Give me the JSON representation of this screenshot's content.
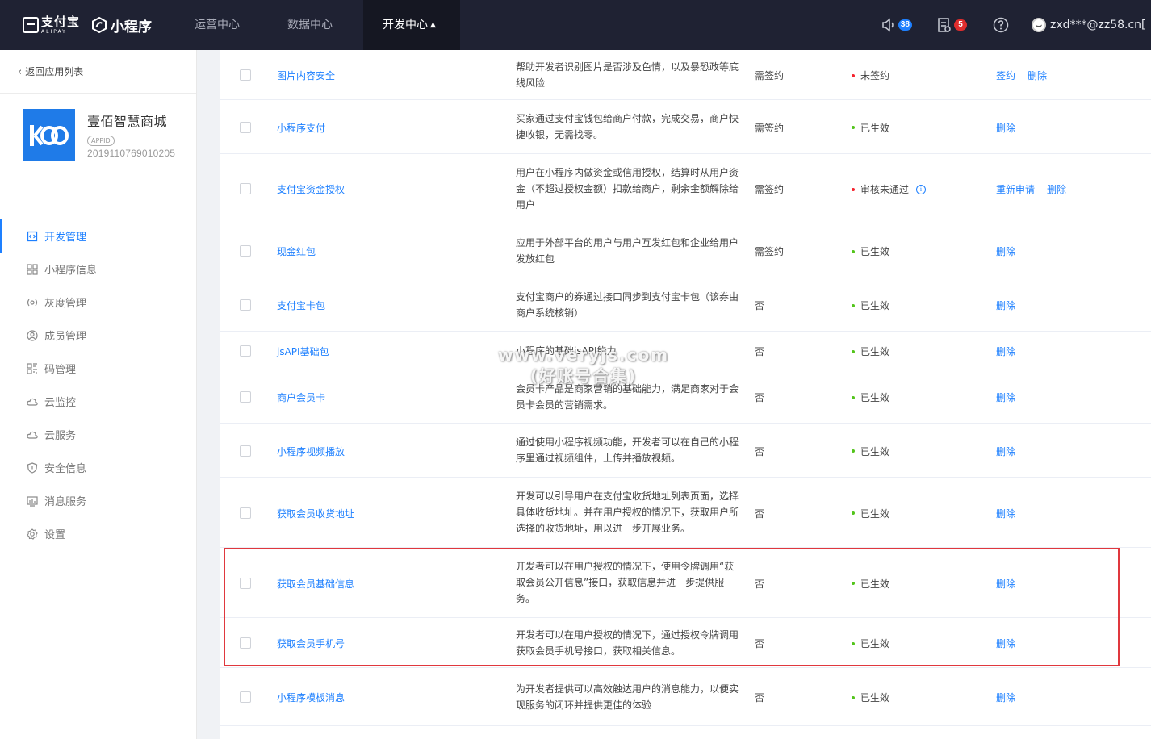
{
  "topbar": {
    "alipay_cn": "支付宝",
    "alipay_en": "ALIPAY",
    "product": "小程序",
    "nav": [
      {
        "label": "运营中心"
      },
      {
        "label": "数据中心"
      },
      {
        "label": "开发中心",
        "active": true
      }
    ],
    "notifications": {
      "icon": "speaker-icon",
      "count": "38"
    },
    "messages": {
      "icon": "document-icon",
      "count": "5"
    },
    "help_icon": "question-icon",
    "user": "zxd***@zz58.cn["
  },
  "sidebar": {
    "back_label": "返回应用列表",
    "app": {
      "name": "壹佰智慧商城",
      "appid_tag": "APPID",
      "appid": "2019110769010205"
    },
    "items": [
      {
        "label": "开发管理",
        "icon": "code-icon",
        "active": true
      },
      {
        "label": "小程序信息",
        "icon": "grid-icon"
      },
      {
        "label": "灰度管理",
        "icon": "broadcast-icon"
      },
      {
        "label": "成员管理",
        "icon": "user-icon"
      },
      {
        "label": "码管理",
        "icon": "qrcode-icon"
      },
      {
        "label": "云监控",
        "icon": "cloud-icon"
      },
      {
        "label": "云服务",
        "icon": "cloud-icon"
      },
      {
        "label": "安全信息",
        "icon": "shield-icon"
      },
      {
        "label": "消息服务",
        "icon": "chart-icon"
      },
      {
        "label": "设置",
        "icon": "gear-icon"
      }
    ]
  },
  "table": {
    "rows": [
      {
        "name": "图片内容安全",
        "desc": "帮助开发者识别图片是否涉及色情，以及暴恐政等底线风险",
        "sign": "需签约",
        "status": "未签约",
        "status_color": "red",
        "ops": [
          "签约",
          "删除"
        ]
      },
      {
        "name": "小程序支付",
        "desc": "买家通过支付宝钱包给商户付款，完成交易，商户快捷收银，无需找零。",
        "sign": "需签约",
        "status": "已生效",
        "status_color": "green",
        "ops": [
          "删除"
        ]
      },
      {
        "name": "支付宝资金授权",
        "desc": "用户在小程序内做资金或信用授权，结算时从用户资金（不超过授权金额）扣款给商户，剩余金额解除给用户",
        "sign": "需签约",
        "status": "审核未通过",
        "status_color": "red",
        "info": true,
        "ops": [
          "重新申请",
          "删除"
        ]
      },
      {
        "name": "现金红包",
        "desc": "应用于外部平台的用户与用户互发红包和企业给用户发放红包",
        "sign": "需签约",
        "status": "已生效",
        "status_color": "green",
        "ops": [
          "删除"
        ]
      },
      {
        "name": "支付宝卡包",
        "desc": "支付宝商户的券通过接口同步到支付宝卡包（该券由商户系统核销）",
        "sign": "否",
        "status": "已生效",
        "status_color": "green",
        "ops": [
          "删除"
        ]
      },
      {
        "name": "jsAPI基础包",
        "desc": "小程序的基础jsAPI能力",
        "sign": "否",
        "status": "已生效",
        "status_color": "green",
        "ops": [
          "删除"
        ]
      },
      {
        "name": "商户会员卡",
        "desc": "会员卡产品是商家营销的基础能力，满足商家对于会员卡会员的营销需求。",
        "sign": "否",
        "status": "已生效",
        "status_color": "green",
        "ops": [
          "删除"
        ]
      },
      {
        "name": "小程序视频播放",
        "desc": "通过使用小程序视频功能，开发者可以在自己的小程序里通过视频组件，上传并播放视频。",
        "sign": "否",
        "status": "已生效",
        "status_color": "green",
        "ops": [
          "删除"
        ]
      },
      {
        "name": "获取会员收货地址",
        "desc": "开发可以引导用户在支付宝收货地址列表页面，选择具体收货地址。并在用户授权的情况下，获取用户所选择的收货地址，用以进一步开展业务。",
        "sign": "否",
        "status": "已生效",
        "status_color": "green",
        "ops": [
          "删除"
        ]
      },
      {
        "name": "获取会员基础信息",
        "desc": "开发者可以在用户授权的情况下，使用令牌调用“获取会员公开信息”接口，获取信息并进一步提供服务。",
        "sign": "否",
        "status": "已生效",
        "status_color": "green",
        "ops": [
          "删除"
        ]
      },
      {
        "name": "获取会员手机号",
        "desc": "开发者可以在用户授权的情况下，通过授权令牌调用获取会员手机号接口，获取相关信息。",
        "sign": "否",
        "status": "已生效",
        "status_color": "green",
        "ops": [
          "删除"
        ]
      },
      {
        "name": "小程序模板消息",
        "desc": "为开发者提供可以高效触达用户的消息能力，以便实现服务的闭环并提供更佳的体验",
        "sign": "否",
        "status": "已生效",
        "status_color": "green",
        "ops": [
          "删除"
        ]
      }
    ]
  },
  "watermark": [
    "www.veryjs.com",
    "(好账号合集)"
  ],
  "colors": {
    "brand_blue": "#1e80ff",
    "topbar": "#1f2233",
    "highlight_red": "#e0383e"
  }
}
